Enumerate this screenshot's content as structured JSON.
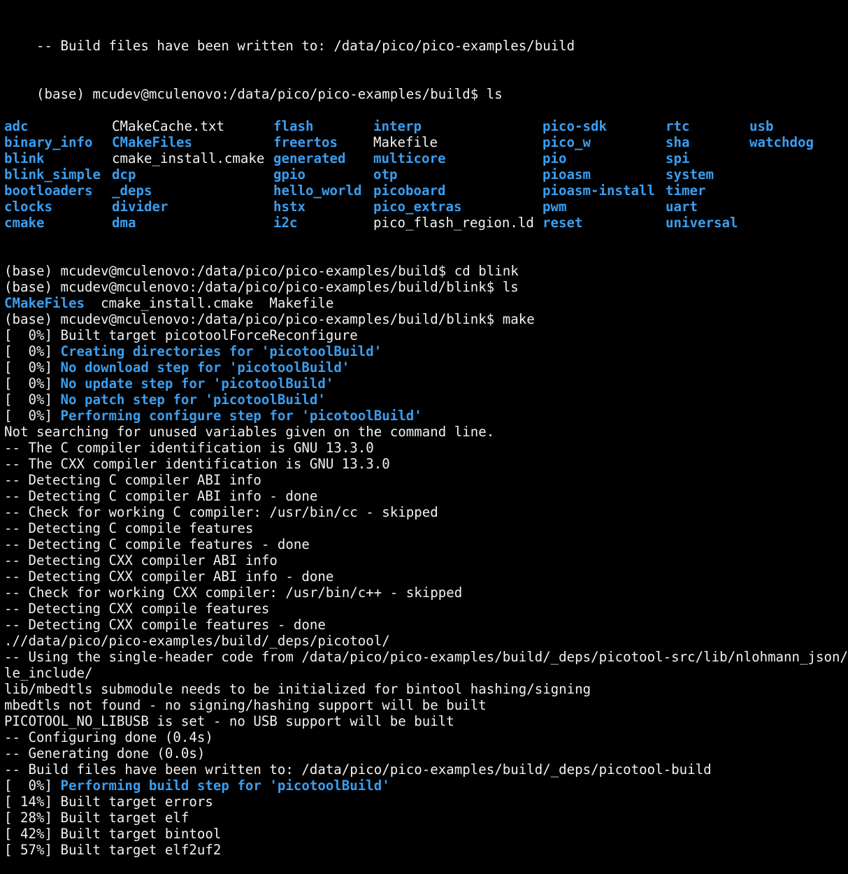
{
  "terminal": {
    "colors": {
      "background": "#000000",
      "text": "#f2f2f2",
      "directory": "#3b9ef0",
      "status": "#3b9ef0"
    },
    "top_line": "-- Build files have been written to: /data/pico/pico-examples/build",
    "prompt_ls": "(base) mcudev@mculenovo:/data/pico/pico-examples/build$ ls",
    "ls_rows": [
      [
        {
          "text": "adc",
          "type": "dir"
        },
        {
          "text": "CMakeCache.txt",
          "type": "file"
        },
        {
          "text": "flash",
          "type": "dir"
        },
        {
          "text": "interp",
          "type": "dir"
        },
        {
          "text": "pico-sdk",
          "type": "dir"
        },
        {
          "text": "rtc",
          "type": "dir"
        },
        {
          "text": "usb",
          "type": "dir"
        }
      ],
      [
        {
          "text": "binary_info",
          "type": "dir"
        },
        {
          "text": "CMakeFiles",
          "type": "dir"
        },
        {
          "text": "freertos",
          "type": "dir"
        },
        {
          "text": "Makefile",
          "type": "file"
        },
        {
          "text": "pico_w",
          "type": "dir"
        },
        {
          "text": "sha",
          "type": "dir"
        },
        {
          "text": "watchdog",
          "type": "dir"
        }
      ],
      [
        {
          "text": "blink",
          "type": "dir"
        },
        {
          "text": "cmake_install.cmake",
          "type": "file"
        },
        {
          "text": "generated",
          "type": "dir"
        },
        {
          "text": "multicore",
          "type": "dir"
        },
        {
          "text": "pio",
          "type": "dir"
        },
        {
          "text": "spi",
          "type": "dir"
        },
        {
          "text": "",
          "type": "file"
        }
      ],
      [
        {
          "text": "blink_simple",
          "type": "dir"
        },
        {
          "text": "dcp",
          "type": "dir"
        },
        {
          "text": "gpio",
          "type": "dir"
        },
        {
          "text": "otp",
          "type": "dir"
        },
        {
          "text": "pioasm",
          "type": "dir"
        },
        {
          "text": "system",
          "type": "dir"
        },
        {
          "text": "",
          "type": "file"
        }
      ],
      [
        {
          "text": "bootloaders",
          "type": "dir"
        },
        {
          "text": "_deps",
          "type": "dir"
        },
        {
          "text": "hello_world",
          "type": "dir"
        },
        {
          "text": "picoboard",
          "type": "dir"
        },
        {
          "text": "pioasm-install",
          "type": "dir"
        },
        {
          "text": "timer",
          "type": "dir"
        },
        {
          "text": "",
          "type": "file"
        }
      ],
      [
        {
          "text": "clocks",
          "type": "dir"
        },
        {
          "text": "divider",
          "type": "dir"
        },
        {
          "text": "hstx",
          "type": "dir"
        },
        {
          "text": "pico_extras",
          "type": "dir"
        },
        {
          "text": "pwm",
          "type": "dir"
        },
        {
          "text": "uart",
          "type": "dir"
        },
        {
          "text": "",
          "type": "file"
        }
      ],
      [
        {
          "text": "cmake",
          "type": "dir"
        },
        {
          "text": "dma",
          "type": "dir"
        },
        {
          "text": "i2c",
          "type": "dir"
        },
        {
          "text": "pico_flash_region.ld",
          "type": "file"
        },
        {
          "text": "reset",
          "type": "dir"
        },
        {
          "text": "universal",
          "type": "dir"
        },
        {
          "text": "",
          "type": "file"
        }
      ]
    ],
    "after_ls": [
      [
        {
          "text": "(base) mcudev@mculenovo:/data/pico/pico-examples/build$ cd blink",
          "style": "plain"
        }
      ],
      [
        {
          "text": "(base) mcudev@mculenovo:/data/pico/pico-examples/build/blink$ ls",
          "style": "plain"
        }
      ],
      [
        {
          "text": "CMakeFiles",
          "style": "dir"
        },
        {
          "text": "  cmake_install.cmake  Makefile",
          "style": "plain"
        }
      ],
      [
        {
          "text": "(base) mcudev@mculenovo:/data/pico/pico-examples/build/blink$ make",
          "style": "plain"
        }
      ],
      [
        {
          "text": "[  0%] Built target picotoolForceReconfigure",
          "style": "plain"
        }
      ],
      [
        {
          "text": "[  0%] ",
          "style": "plain"
        },
        {
          "text": "Creating directories for 'picotoolBuild'",
          "style": "status"
        }
      ],
      [
        {
          "text": "[  0%] ",
          "style": "plain"
        },
        {
          "text": "No download step for 'picotoolBuild'",
          "style": "status"
        }
      ],
      [
        {
          "text": "[  0%] ",
          "style": "plain"
        },
        {
          "text": "No update step for 'picotoolBuild'",
          "style": "status"
        }
      ],
      [
        {
          "text": "[  0%] ",
          "style": "plain"
        },
        {
          "text": "No patch step for 'picotoolBuild'",
          "style": "status"
        }
      ],
      [
        {
          "text": "[  0%] ",
          "style": "plain"
        },
        {
          "text": "Performing configure step for 'picotoolBuild'",
          "style": "status"
        }
      ],
      [
        {
          "text": "Not searching for unused variables given on the command line.",
          "style": "plain"
        }
      ],
      [
        {
          "text": "-- The C compiler identification is GNU 13.3.0",
          "style": "plain"
        }
      ],
      [
        {
          "text": "-- The CXX compiler identification is GNU 13.3.0",
          "style": "plain"
        }
      ],
      [
        {
          "text": "-- Detecting C compiler ABI info",
          "style": "plain"
        }
      ],
      [
        {
          "text": "-- Detecting C compiler ABI info - done",
          "style": "plain"
        }
      ],
      [
        {
          "text": "-- Check for working C compiler: /usr/bin/cc - skipped",
          "style": "plain"
        }
      ],
      [
        {
          "text": "-- Detecting C compile features",
          "style": "plain"
        }
      ],
      [
        {
          "text": "-- Detecting C compile features - done",
          "style": "plain"
        }
      ],
      [
        {
          "text": "-- Detecting CXX compiler ABI info",
          "style": "plain"
        }
      ],
      [
        {
          "text": "-- Detecting CXX compiler ABI info - done",
          "style": "plain"
        }
      ],
      [
        {
          "text": "-- Check for working CXX compiler: /usr/bin/c++ - skipped",
          "style": "plain"
        }
      ],
      [
        {
          "text": "-- Detecting CXX compile features",
          "style": "plain"
        }
      ],
      [
        {
          "text": "-- Detecting CXX compile features - done",
          "style": "plain"
        }
      ],
      [
        {
          "text": ".//data/pico/pico-examples/build/_deps/picotool/",
          "style": "plain"
        }
      ],
      [
        {
          "text": "-- Using the single-header code from /data/pico/pico-examples/build/_deps/picotool-src/lib/nlohmann_json/sing",
          "style": "plain"
        }
      ],
      [
        {
          "text": "le_include/",
          "style": "plain"
        }
      ],
      [
        {
          "text": "lib/mbedtls submodule needs to be initialized for bintool hashing/signing",
          "style": "plain"
        }
      ],
      [
        {
          "text": "mbedtls not found - no signing/hashing support will be built",
          "style": "plain"
        }
      ],
      [
        {
          "text": "PICOTOOL_NO_LIBUSB is set - no USB support will be built",
          "style": "plain"
        }
      ],
      [
        {
          "text": "-- Configuring done (0.4s)",
          "style": "plain"
        }
      ],
      [
        {
          "text": "-- Generating done (0.0s)",
          "style": "plain"
        }
      ],
      [
        {
          "text": "-- Build files have been written to: /data/pico/pico-examples/build/_deps/picotool-build",
          "style": "plain"
        }
      ],
      [
        {
          "text": "[  0%] ",
          "style": "plain"
        },
        {
          "text": "Performing build step for 'picotoolBuild'",
          "style": "status"
        }
      ],
      [
        {
          "text": "[ 14%] Built target errors",
          "style": "plain"
        }
      ],
      [
        {
          "text": "[ 28%] Built target elf",
          "style": "plain"
        }
      ],
      [
        {
          "text": "[ 42%] Built target bintool",
          "style": "plain"
        }
      ],
      [
        {
          "text": "[ 57%] Built target elf2uf2",
          "style": "plain"
        }
      ]
    ]
  }
}
